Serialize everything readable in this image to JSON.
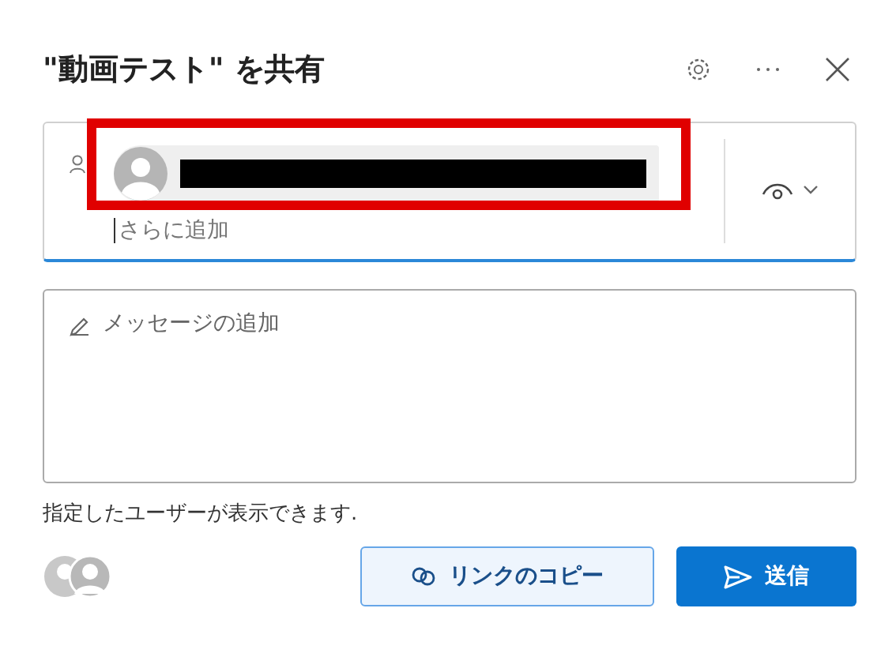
{
  "title": "\"動画テスト\" を共有",
  "recipients": {
    "placeholder": "さらに追加",
    "chips": [
      {
        "kind": "redacted"
      }
    ]
  },
  "message": {
    "placeholder": "メッセージの追加"
  },
  "note": "指定したユーザーが表示できます.",
  "buttons": [
    {
      "kind": "secondary",
      "label": "リンクのコピー"
    },
    {
      "kind": "primary",
      "label": "送信"
    }
  ]
}
